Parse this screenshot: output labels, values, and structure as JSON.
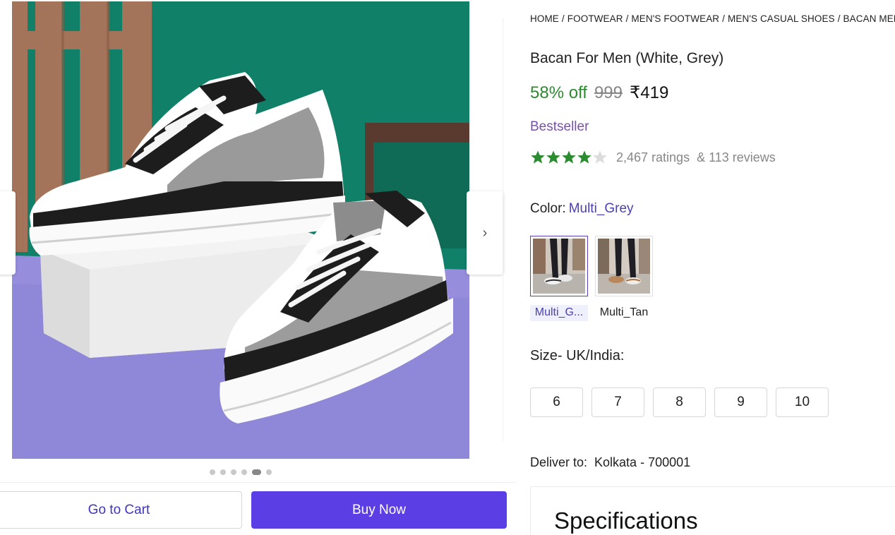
{
  "breadcrumb": [
    "HOME",
    "FOOTWEAR",
    "MEN'S FOOTWEAR",
    "MEN'S CASUAL SHOES",
    "BACAN MEN'S"
  ],
  "product": {
    "title": "Bacan For Men (White, Grey)",
    "discount": "58% off",
    "mrp": "999",
    "price": "₹419",
    "badge": "Bestseller",
    "rating_stars": 4,
    "ratings": "2,467 ratings",
    "reviews": "& 113 reviews"
  },
  "color": {
    "label": "Color:",
    "selected": "Multi_Grey",
    "options": [
      {
        "name": "Multi_G...",
        "selected": true
      },
      {
        "name": "Multi_Tan",
        "selected": false
      }
    ]
  },
  "size": {
    "label": "Size- UK/India:",
    "options": [
      "6",
      "7",
      "8",
      "9",
      "10"
    ]
  },
  "delivery": {
    "label": "Deliver to:",
    "location": "Kolkata - 700001"
  },
  "specifications": {
    "title": "Specifications"
  },
  "gallery": {
    "image_count": 6,
    "active_index": 4,
    "next_icon": "chevron-right-icon",
    "prev_icon": "chevron-left-icon"
  },
  "actions": {
    "cart_label": "Go to Cart",
    "buy_label": "Buy Now"
  },
  "colors": {
    "accent": "#5b3fe4",
    "discount": "#2a8c2e",
    "star": "#2a8c2e",
    "bestseller": "#7a4fb0"
  }
}
